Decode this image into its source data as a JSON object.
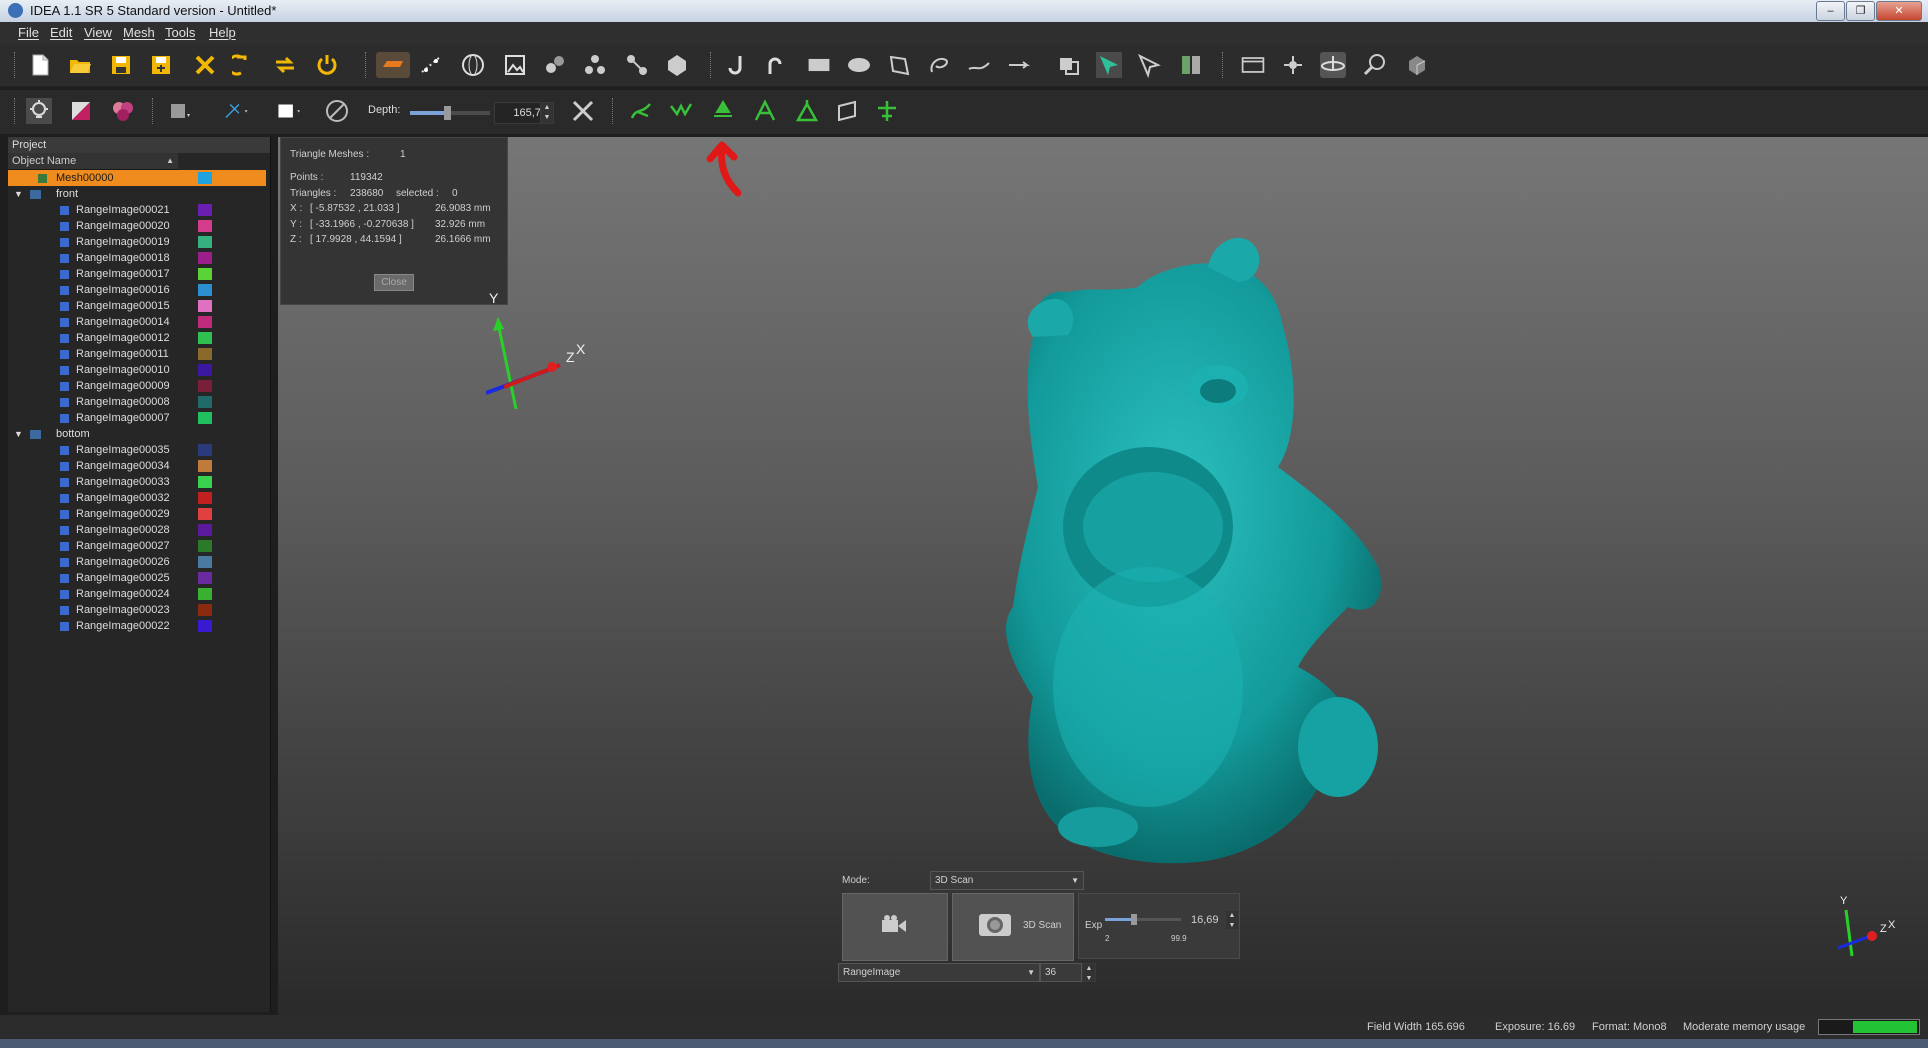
{
  "window": {
    "title": "IDEA 1.1 SR 5 Standard version - Untitled*",
    "buttons": [
      "–",
      "❐",
      "✕"
    ]
  },
  "menu": [
    "File",
    "Edit",
    "View",
    "Mesh",
    "Tools",
    "Help"
  ],
  "toolbar2": {
    "depth_label": "Depth:",
    "depth_value": "165,70"
  },
  "project": {
    "header": "Project",
    "column": "Object Name",
    "mesh": {
      "name": "Mesh00000",
      "color": "#1fa3e0"
    },
    "groups": [
      {
        "name": "front",
        "items": [
          {
            "name": "RangeImage00021",
            "color": "#6a1fb0"
          },
          {
            "name": "RangeImage00020",
            "color": "#d23c8a"
          },
          {
            "name": "RangeImage00019",
            "color": "#35b07e"
          },
          {
            "name": "RangeImage00018",
            "color": "#9a1f8a"
          },
          {
            "name": "RangeImage00017",
            "color": "#5bd235"
          },
          {
            "name": "RangeImage00016",
            "color": "#2b8fd0"
          },
          {
            "name": "RangeImage00015",
            "color": "#e070c0"
          },
          {
            "name": "RangeImage00014",
            "color": "#c02a7a"
          },
          {
            "name": "RangeImage00012",
            "color": "#2fc050"
          },
          {
            "name": "RangeImage00011",
            "color": "#8a6a2a"
          },
          {
            "name": "RangeImage00010",
            "color": "#3a18a0"
          },
          {
            "name": "RangeImage00009",
            "color": "#7a1f3a"
          },
          {
            "name": "RangeImage00008",
            "color": "#206a6a"
          },
          {
            "name": "RangeImage00007",
            "color": "#20c060"
          }
        ]
      },
      {
        "name": "bottom",
        "items": [
          {
            "name": "RangeImage00035",
            "color": "#2a3a7a"
          },
          {
            "name": "RangeImage00034",
            "color": "#c07a3a"
          },
          {
            "name": "RangeImage00033",
            "color": "#3ad050"
          },
          {
            "name": "RangeImage00032",
            "color": "#c02020"
          },
          {
            "name": "RangeImage00029",
            "color": "#e04040"
          },
          {
            "name": "RangeImage00028",
            "color": "#5a1a9a"
          },
          {
            "name": "RangeImage00027",
            "color": "#2a7a2a"
          },
          {
            "name": "RangeImage00026",
            "color": "#4a7aa0"
          },
          {
            "name": "RangeImage00025",
            "color": "#6a2aa0"
          },
          {
            "name": "RangeImage00024",
            "color": "#3ab030"
          },
          {
            "name": "RangeImage00023",
            "color": "#8a2a10"
          },
          {
            "name": "RangeImage00022",
            "color": "#3a1ad0"
          }
        ]
      }
    ]
  },
  "info": {
    "meshes_label": "Triangle Meshes :",
    "meshes_value": "1",
    "points_label": "Points :",
    "points_value": "119342",
    "triangles_label": "Triangles :",
    "triangles_value": "238680",
    "selected_label": "selected :",
    "selected_value": "0",
    "x_label": "X :",
    "x_range": "[ -5.87532 , 21.033 ]",
    "x_size": "26.9083 mm",
    "y_label": "Y :",
    "y_range": "[ -33.1966 , -0.270638 ]",
    "y_size": "32.926 mm",
    "z_label": "Z :",
    "z_range": "[ 17.9928 , 44.1594 ]",
    "z_size": "26.1666 mm",
    "close": "Close"
  },
  "axes": {
    "y": "Y",
    "z": "Z",
    "x": "X"
  },
  "scan": {
    "mode_label": "Mode:",
    "mode_value": "3D Scan",
    "scan_button": "3D Scan",
    "exp_label": "Exp",
    "exp_value": "16,69",
    "exp_min": "2",
    "exp_max": "99.9",
    "source": "RangeImage",
    "count": "36"
  },
  "status": {
    "field_width": "Field Width 165.696",
    "exposure": "Exposure: 16.69",
    "format": "Format: Mono8",
    "memory": "Moderate memory usage"
  },
  "colors": {
    "mesh": "#119a9a",
    "selection": "#f08c1e",
    "annotation": "#e01818"
  }
}
